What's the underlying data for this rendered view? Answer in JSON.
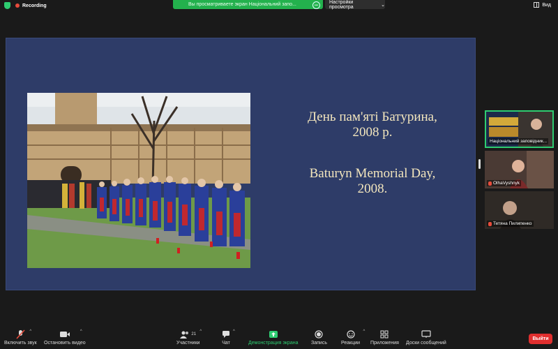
{
  "top": {
    "recording_label": "Recording",
    "share_banner_text": "Вы просматриваете экран Національний запо...",
    "view_settings_label": "Настройки просмотра",
    "view_label": "Вид"
  },
  "slide": {
    "title_uk_line1": "День пам'яті Батурина,",
    "title_uk_line2": "2008 р.",
    "title_en_line1": "Baturyn Memorial Day,",
    "title_en_line2": "2008."
  },
  "participants": [
    {
      "name": "Національний заповідник...",
      "speaking": true
    },
    {
      "name": "OlhaVyshnyk",
      "muted": true
    },
    {
      "name": "Тетяна Пилипенко",
      "muted": true
    }
  ],
  "toolbar": {
    "audio_label": "Включить звук",
    "video_label": "Остановить видео",
    "participants_label": "Участники",
    "participants_count": "21",
    "chat_label": "Чат",
    "share_label": "Демонстрация экрана",
    "record_label": "Запись",
    "reactions_label": "Реакции",
    "apps_label": "Приложения",
    "whiteboard_label": "Доски сообщений",
    "exit_label": "Выйти"
  },
  "colors": {
    "slide_bg": "#2e3c68",
    "slide_text": "#f3e6bd",
    "share_green": "#23b14d",
    "exit_red": "#e02f2f"
  }
}
